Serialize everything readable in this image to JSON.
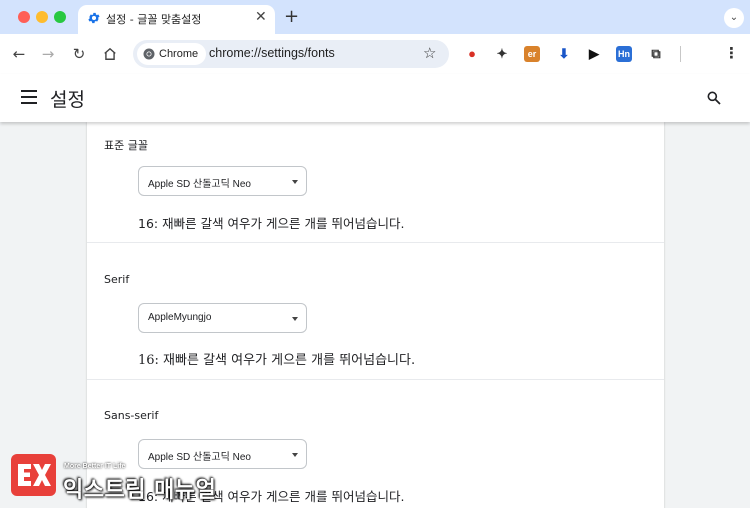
{
  "browser": {
    "tab_title": "설정 - 글꼴 맞춤설정",
    "close_symbol": "✕",
    "new_tab_symbol": "+",
    "url_chip_label": "Chrome",
    "url": "chrome://settings/fonts",
    "extensions": [
      {
        "name": "record-extension-icon",
        "glyph": "●",
        "color": "#d93025"
      },
      {
        "name": "puzzle-tool-icon",
        "glyph": "✦",
        "color": "#333333"
      },
      {
        "name": "er-extension-icon",
        "glyph": "er",
        "color": "#d9822b"
      },
      {
        "name": "download-arrow-icon",
        "glyph": "⬇",
        "color": "#1a56c8"
      },
      {
        "name": "play-extension-icon",
        "glyph": "▶",
        "color": "#111111"
      },
      {
        "name": "hn-extension-icon",
        "glyph": "Hn",
        "color": "#2b6fd6"
      },
      {
        "name": "extensions-puzzle-icon",
        "glyph": "⧉",
        "color": "#333333"
      }
    ]
  },
  "settings": {
    "title": "설정"
  },
  "fonts": {
    "sections": [
      {
        "label": "표준 글꼴",
        "selected": "Apple SD 산돌고딕 Neo",
        "sample": "16: 재빠른 갈색 여우가 게으른 개를 뛰어넘습니다.",
        "style": "sans"
      },
      {
        "label": "Serif",
        "selected": "AppleMyungjo",
        "sample": "16: 재빠른 갈색 여우가 게으른 개를 뛰어넘습니다.",
        "style": "serif"
      },
      {
        "label": "Sans-serif",
        "selected": "Apple SD 산돌고딕 Neo",
        "sample": "16: 재빠른 갈색 여우가 게으른 개를 뛰어넘습니다.",
        "style": "sans"
      }
    ]
  },
  "watermark": {
    "tagline": "More Better IT Life",
    "name": "익스트림 매뉴얼"
  }
}
